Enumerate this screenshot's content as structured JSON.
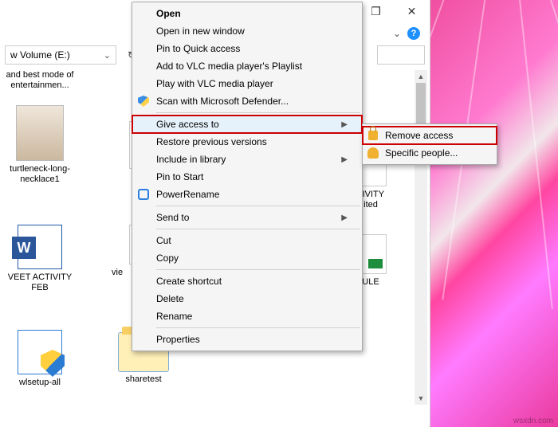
{
  "path": "w Volume (E:)",
  "titlebar_buttons": {
    "restore": "❐",
    "close": "✕"
  },
  "help_icon": "?",
  "files": {
    "f0": "and best mode of entertainmen...",
    "f1": "turtleneck-long-necklace1",
    "f2": "VEET ACTIVITY FEB",
    "f3": "wlsetup-all",
    "f4": "vie",
    "f5": "sharetest",
    "f6": "TIVITY",
    "f6b": "ited",
    "f7": "ULE"
  },
  "menu": [
    {
      "key": "open",
      "label": "Open",
      "bold": true
    },
    {
      "key": "open-new",
      "label": "Open in new window"
    },
    {
      "key": "pin-qa",
      "label": "Pin to Quick access"
    },
    {
      "key": "add-vlc",
      "label": "Add to VLC media player's Playlist"
    },
    {
      "key": "play-vlc",
      "label": "Play with VLC media player"
    },
    {
      "key": "scan-def",
      "label": "Scan with Microsoft Defender...",
      "icon": "shield"
    },
    {
      "sep": true
    },
    {
      "key": "give-access",
      "label": "Give access to",
      "arrow": true,
      "hover": true,
      "hl": true
    },
    {
      "key": "restore-ver",
      "label": "Restore previous versions"
    },
    {
      "key": "incl-lib",
      "label": "Include in library",
      "arrow": true
    },
    {
      "key": "pin-start",
      "label": "Pin to Start"
    },
    {
      "key": "powerrename",
      "label": "PowerRename",
      "icon": "power"
    },
    {
      "sep": true
    },
    {
      "key": "send-to",
      "label": "Send to",
      "arrow": true
    },
    {
      "sep": true
    },
    {
      "key": "cut",
      "label": "Cut"
    },
    {
      "key": "copy",
      "label": "Copy"
    },
    {
      "sep": true
    },
    {
      "key": "shortcut",
      "label": "Create shortcut"
    },
    {
      "key": "delete",
      "label": "Delete"
    },
    {
      "key": "rename",
      "label": "Rename"
    },
    {
      "sep": true
    },
    {
      "key": "properties",
      "label": "Properties"
    }
  ],
  "submenu": [
    {
      "key": "remove-access",
      "label": "Remove access",
      "icon": "padlock",
      "hl": true
    },
    {
      "key": "specific-people",
      "label": "Specific people...",
      "icon": "people"
    }
  ],
  "watermark": "wsxdn.com"
}
